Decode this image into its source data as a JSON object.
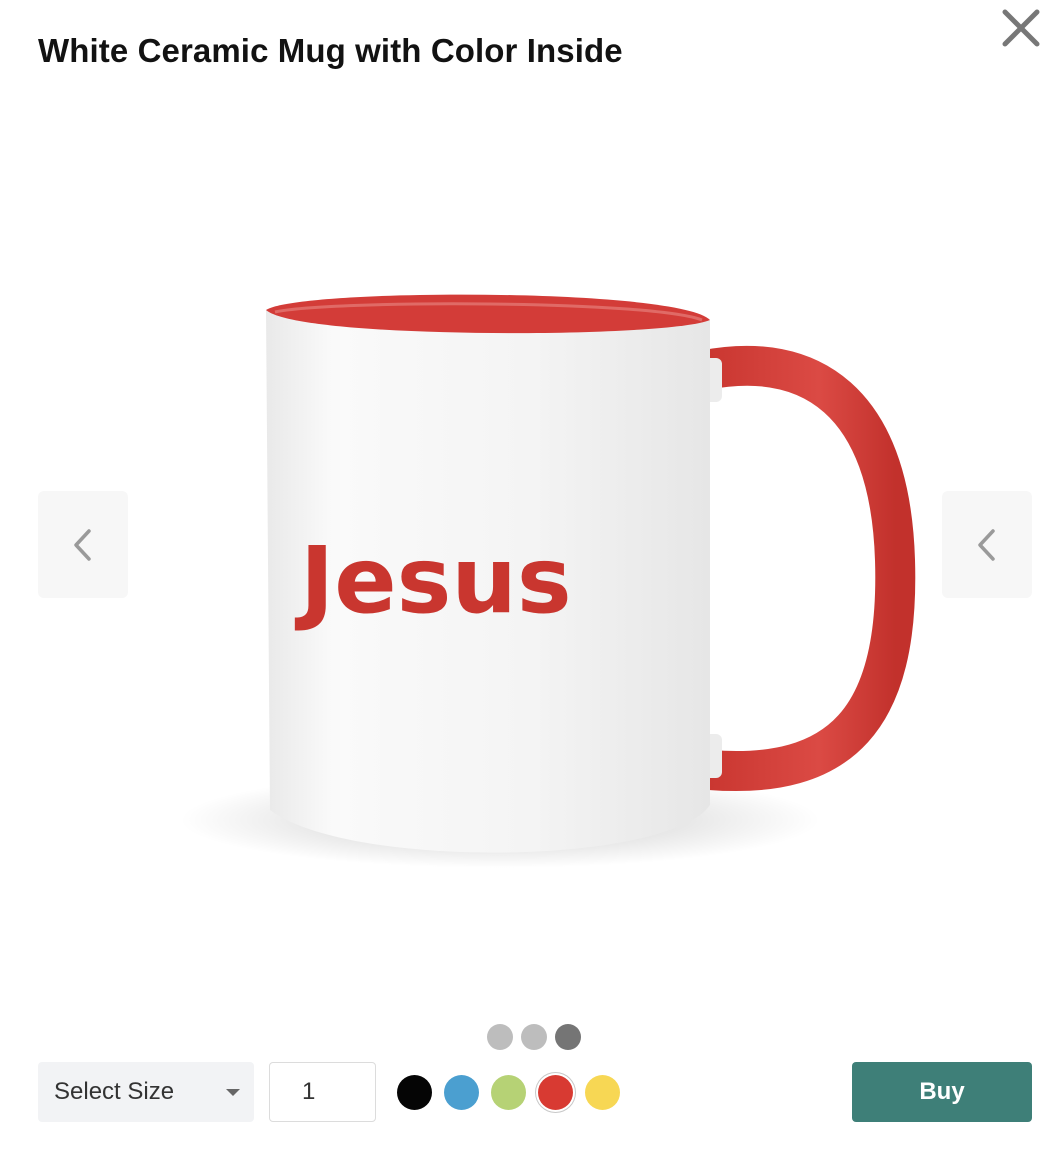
{
  "product": {
    "title": "White Ceramic Mug with Color Inside",
    "mug_print_text": "Jesus",
    "image_icon": "mug-product-image",
    "accent_color": "#cc3a3a"
  },
  "controls": {
    "close_icon": "close-icon",
    "prev_icon": "chevron-left-icon",
    "next_icon": "chevron-left-icon"
  },
  "carousel": {
    "total_slides": 3,
    "active_index": 2
  },
  "purchase": {
    "size_label": "Select Size",
    "quantity": "1",
    "buy_label": "Buy",
    "buy_color": "#3e7f78",
    "colors": [
      {
        "name": "black",
        "hex": "#050505",
        "selected": false
      },
      {
        "name": "blue",
        "hex": "#4b9fd0",
        "selected": false
      },
      {
        "name": "green",
        "hex": "#b6d275",
        "selected": false
      },
      {
        "name": "red",
        "hex": "#d83a32",
        "selected": true
      },
      {
        "name": "yellow",
        "hex": "#f7d754",
        "selected": false
      }
    ]
  }
}
